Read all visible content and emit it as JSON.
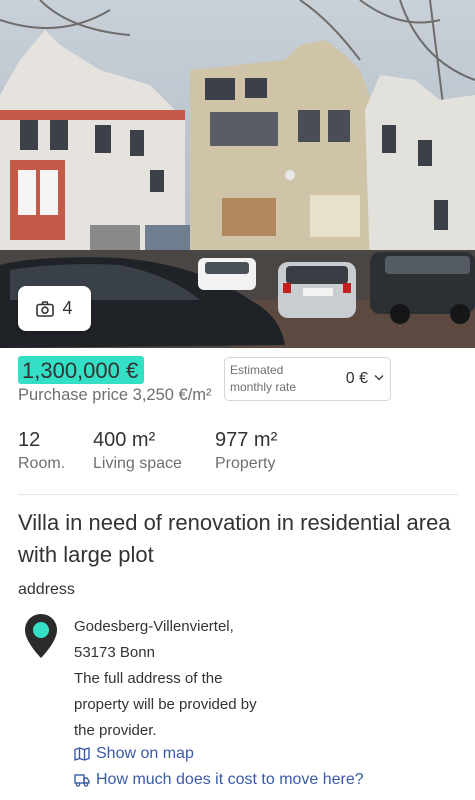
{
  "listing": {
    "photo_count": "4",
    "price": "1,300,000 €",
    "price_per_sqm": "Purchase price 3,250 €/m²",
    "rate": {
      "label": "Estimated monthly rate",
      "value": "0 €"
    },
    "facts": [
      {
        "value": "12",
        "label": "Room."
      },
      {
        "value": "400 m²",
        "label": "Living space"
      },
      {
        "value": "977 m²",
        "label": "Property"
      }
    ],
    "title": "Villa in need of renovation in residential area with large plot",
    "address_heading": "address",
    "address_lines": [
      "Godesberg-Villenviertel,",
      "53173 Bonn",
      "The full address of the",
      "property will be provided by",
      "the provider."
    ],
    "links": {
      "show_on_map": "Show on map",
      "moving_cost": "How much does it cost to move here?"
    },
    "icons": {
      "photo": "camera-icon",
      "rate_dropdown": "chevron-down-icon",
      "location": "map-pin-icon",
      "map": "map-icon",
      "moving": "truck-icon"
    },
    "colors": {
      "price_highlight": "#33e0c6",
      "link": "#3a5aa8",
      "pin_dot": "#33e0c6"
    }
  }
}
